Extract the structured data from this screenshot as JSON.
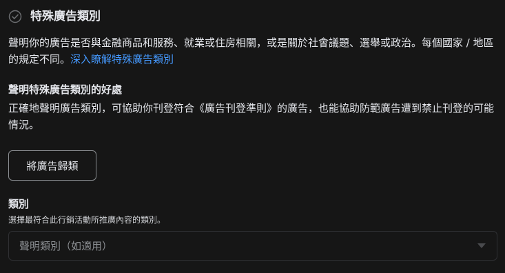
{
  "section": {
    "title": "特殊廣告類別",
    "status_icon": "check-circle-icon"
  },
  "description": {
    "text": "聲明你的廣告是否與金融商品和服務、就業或住房相關，或是關於社會議題、選舉或政治。每個國家 / 地區的規定不同。",
    "link": "深入瞭解特殊廣告類別"
  },
  "benefits": {
    "title": "聲明特殊廣告類別的好處",
    "text": "正確地聲明廣告類別，可協助你刊登符合《廣告刊登準則》的廣告，也能協助防範廣告遭到禁止刊登的可能情況。"
  },
  "classify_button": {
    "label": "將廣告歸類"
  },
  "category_field": {
    "label": "類別",
    "help": "選擇最符合此行銷活動所推廣內容的類別。",
    "placeholder": "聲明類別（如適用）",
    "caret_icon": "caret-down-icon"
  },
  "colors": {
    "background": "#161616",
    "text": "#e4e6eb",
    "link": "#4599ff",
    "muted": "#8a8d91"
  }
}
